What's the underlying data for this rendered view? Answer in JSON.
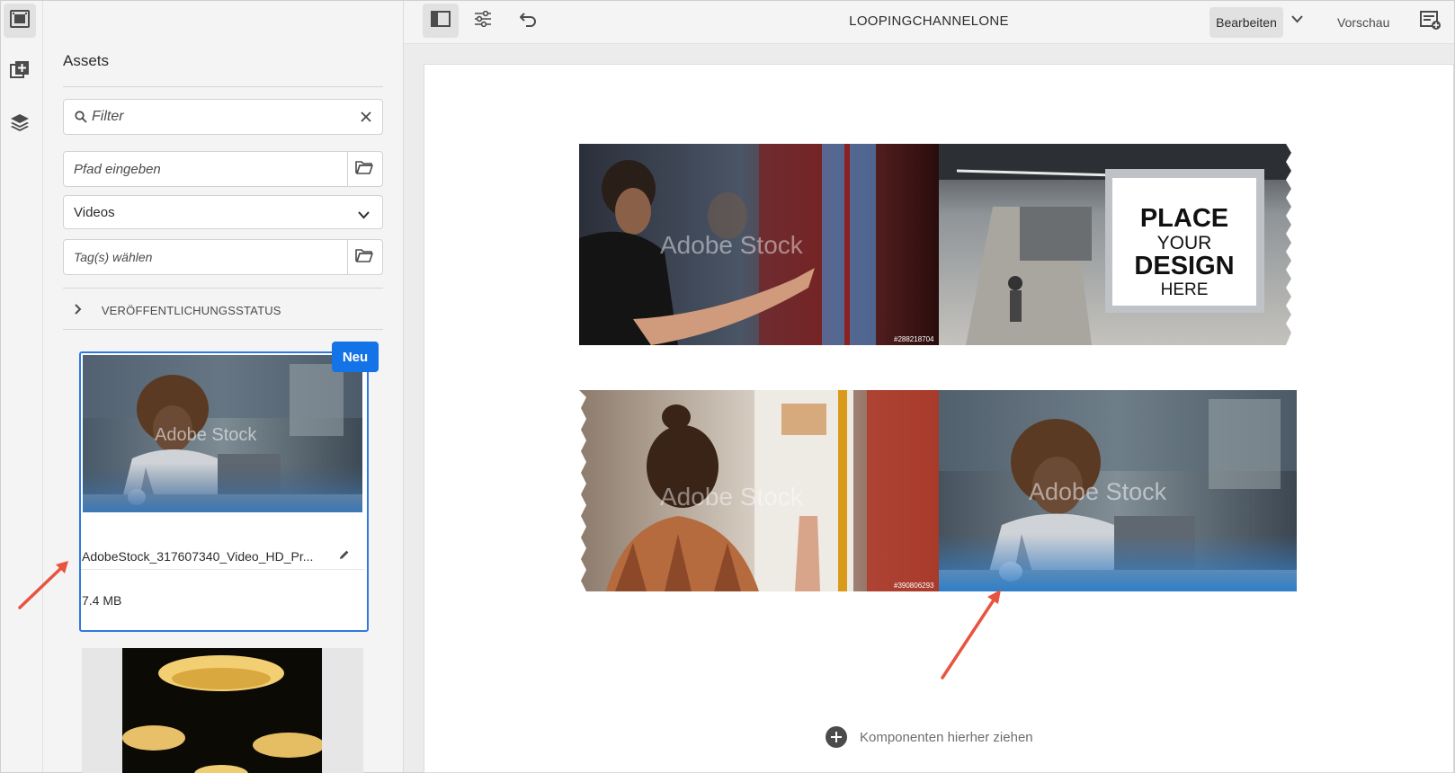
{
  "window": {
    "title": "LOOPINGCHANNELONE"
  },
  "rail": {
    "icons": [
      "assets-icon",
      "components-icon",
      "layers-icon"
    ]
  },
  "panel": {
    "title": "Assets",
    "filter": {
      "placeholder": "Filter"
    },
    "path": {
      "placeholder": "Pfad eingeben"
    },
    "type_select": {
      "value": "Videos"
    },
    "tags": {
      "placeholder": "Tag(s) wählen"
    },
    "publish_status": {
      "label": "VERÖFFENTLICHUNGSSTATUS"
    },
    "assets": [
      {
        "badge": "Neu",
        "name": "AdobeStock_317607340_Video_HD_Pr...",
        "size": "7.4 MB",
        "selected": true
      },
      {
        "name": "",
        "size": ""
      }
    ]
  },
  "toolbar": {
    "edit_label": "Bearbeiten",
    "preview_label": "Vorschau"
  },
  "canvas": {
    "tiles": [
      {
        "watermark": "Adobe Stock",
        "caption": "#288218704"
      },
      {
        "billboard_lines": [
          "PLACE",
          "YOUR",
          "DESIGN",
          "HERE"
        ]
      },
      {
        "watermark": "Adobe Stock",
        "caption": "#390806293"
      },
      {
        "watermark": "Adobe Stock"
      }
    ],
    "drop_hint": "Komponenten hierher ziehen"
  },
  "colors": {
    "accent": "#1473e6",
    "selection": "#2f7ae0",
    "annotation_arrow": "#e8543f"
  }
}
